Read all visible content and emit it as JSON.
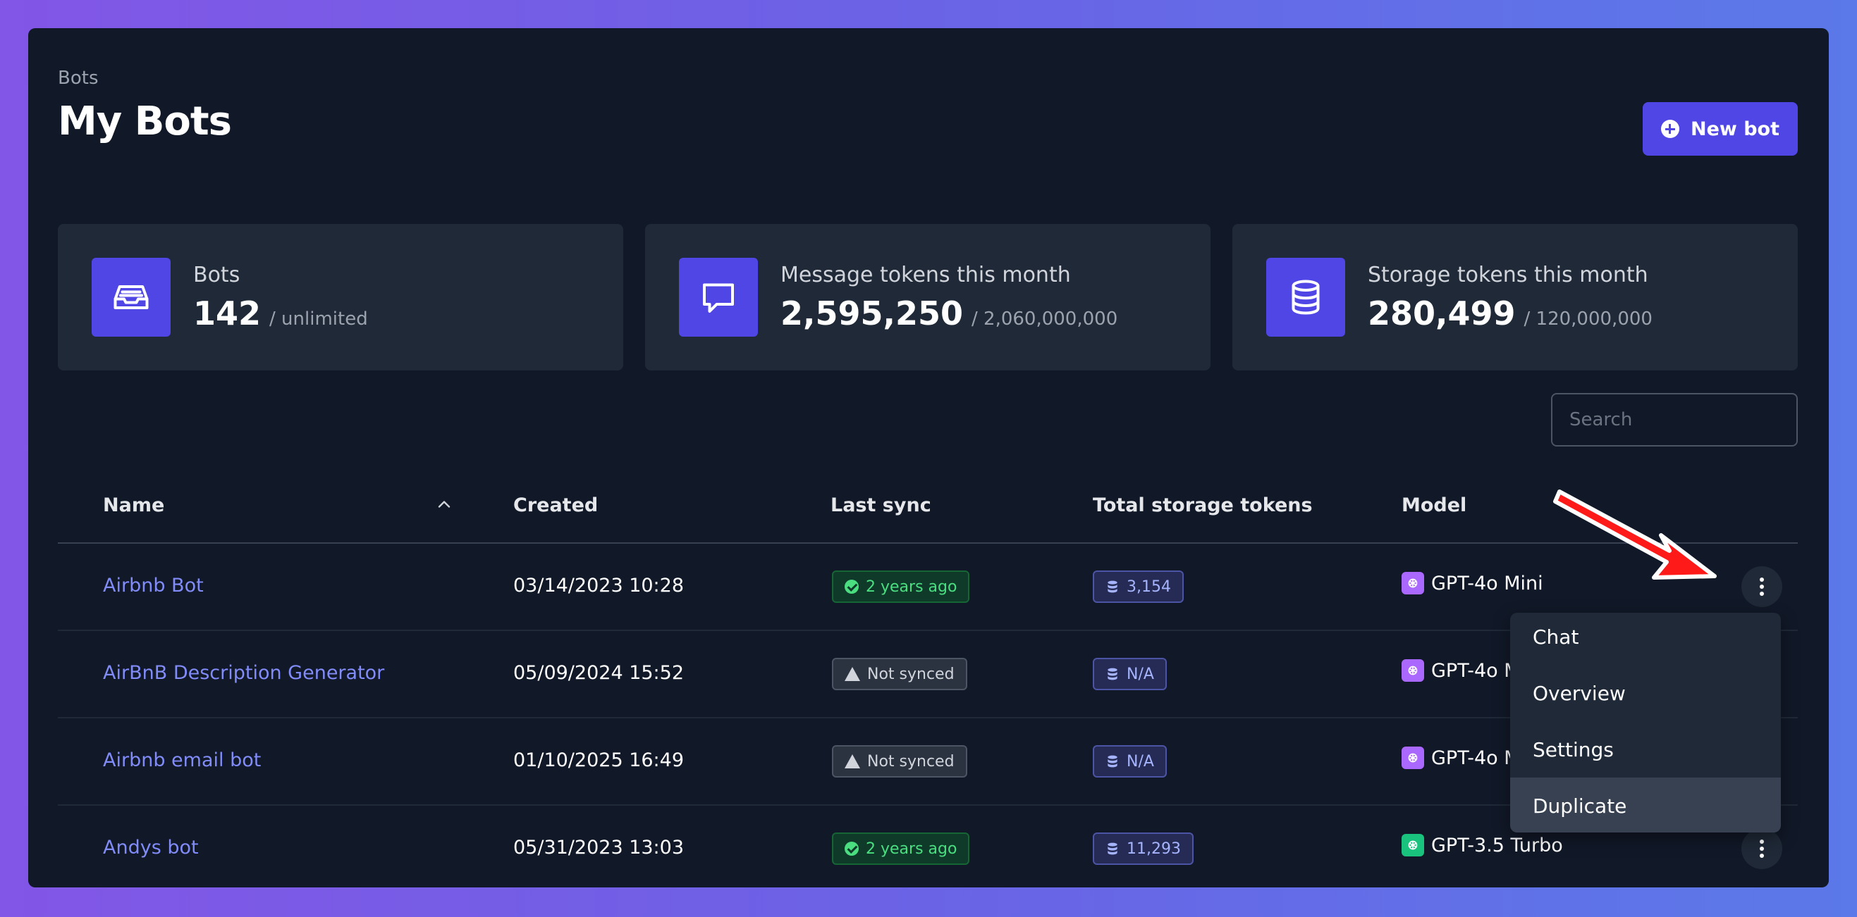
{
  "breadcrumb": "Bots",
  "page_title": "My Bots",
  "new_bot_label": "New bot",
  "stats": [
    {
      "label": "Bots",
      "value": "142",
      "sub": "/ unlimited",
      "icon": "inbox-icon"
    },
    {
      "label": "Message tokens this month",
      "value": "2,595,250",
      "sub": "/ 2,060,000,000",
      "icon": "chat-bubble-icon"
    },
    {
      "label": "Storage tokens this month",
      "value": "280,499",
      "sub": "/ 120,000,000",
      "icon": "database-icon"
    }
  ],
  "search": {
    "placeholder": "Search"
  },
  "table": {
    "headers": {
      "name": "Name",
      "created": "Created",
      "last_sync": "Last sync",
      "storage": "Total storage tokens",
      "model": "Model"
    },
    "rows": [
      {
        "name": "Airbnb Bot",
        "created": "03/14/2023 10:28",
        "sync": "2 years ago",
        "synced": true,
        "tokens": "3,154",
        "model": "GPT-4o Mini"
      },
      {
        "name": "AirBnB Description Generator",
        "created": "05/09/2024 15:52",
        "sync": "Not synced",
        "synced": false,
        "tokens": "N/A",
        "model": "GPT-4o M"
      },
      {
        "name": "Airbnb email bot",
        "created": "01/10/2025 16:49",
        "sync": "Not synced",
        "synced": false,
        "tokens": "N/A",
        "model": "GPT-4o M"
      },
      {
        "name": "Andys bot",
        "created": "05/31/2023 13:03",
        "sync": "2 years ago",
        "synced": true,
        "tokens": "11,293",
        "model": "GPT-3.5 Turbo"
      }
    ]
  },
  "menu": [
    "Chat",
    "Overview",
    "Settings",
    "Duplicate"
  ],
  "colors": {
    "accent": "#4f46e5",
    "panel": "#111827",
    "card": "#1f2937",
    "link": "#818cf8",
    "arrow": "#ff1a1a"
  }
}
